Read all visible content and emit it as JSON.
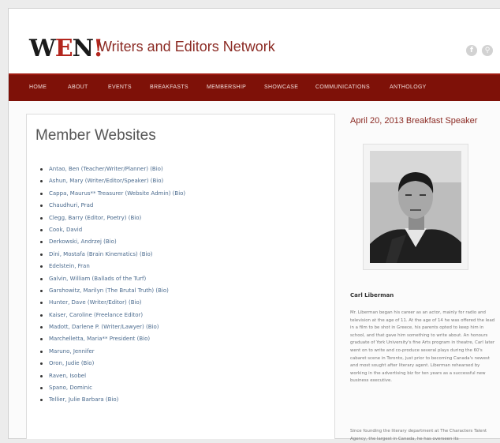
{
  "site": {
    "logo_text": "WEN!",
    "title": "Writers and Editors Network",
    "social_icons": [
      "facebook-icon",
      "search-icon"
    ]
  },
  "nav": {
    "items": [
      "Home",
      "About",
      "Events",
      "Breakfasts",
      "Membership",
      "Showcase",
      "Communications",
      "Anthology"
    ]
  },
  "main": {
    "title": "Member Websites",
    "members": [
      "Antao, Ben (Teacher/Writer/Planner) (Bio)",
      "Ashun, Mary (Writer/Editor/Speaker) (Bio)",
      "Cappa, Maurus** Treasurer (Website Admin) (Bio)",
      "Chaudhuri, Prad",
      "Clegg, Barry (Editor, Poetry) (Bio)",
      "Cook, David",
      "Derkowski, Andrzej (Bio)",
      "Dini, Mostafa (Brain Kinematics) (Bio)",
      "Edelstein, Fran",
      "Galvin, William (Ballads of the Turf)",
      "Garshowitz, Marilyn (The Brutal Truth) (Bio)",
      "Hunter, Dave (Writer/Editor) (Bio)",
      "Kaiser, Caroline (Freelance Editor)",
      "Madott, Darlene P. (Writer/Lawyer) (Bio)",
      "Marchelletta, Maria** President (Bio)",
      "Maruno, Jennifer",
      "Oron, Judie (Bio)",
      "Raven, Isobel",
      "Spano, Dominic",
      "Tellier, Julie Barbara (Bio)"
    ]
  },
  "sidebar": {
    "date_heading": "April 20, 2013 Breakfast Speaker",
    "caption": "Carl Liberman",
    "bio_p1": "Mr. Liberman began his career as an actor, mainly for radio and television at the age of 11. At the age of 14 he was offered the lead in a film to be shot in Greece, his parents opted to keep him in school, and that gave him something to write about. An honours graduate of York University's fine Arts program in theatre, Carl later went on to write and co-produce several plays during the 60's cabaret scene in Toronto, just prior to becoming Canada's newest and most sought after literary agent. Liberman rehearsed by working in the advertising biz for ten years as a successful new business executive.",
    "bio_p2": "Since founding the literary department at The Characters Talent Agency, the largest in Canada, he has overseen its"
  }
}
